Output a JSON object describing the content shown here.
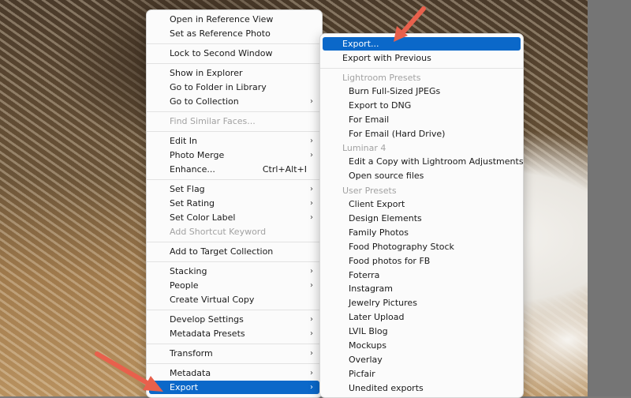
{
  "context_menu": {
    "groups": [
      [
        {
          "label": "Open in Reference View",
          "submenu": false,
          "enabled": true
        },
        {
          "label": "Set as Reference Photo",
          "submenu": false,
          "enabled": true
        }
      ],
      [
        {
          "label": "Lock to Second Window",
          "submenu": false,
          "enabled": true
        }
      ],
      [
        {
          "label": "Show in Explorer",
          "submenu": false,
          "enabled": true
        },
        {
          "label": "Go to Folder in Library",
          "submenu": false,
          "enabled": true
        },
        {
          "label": "Go to Collection",
          "submenu": true,
          "enabled": true
        }
      ],
      [
        {
          "label": "Find Similar Faces...",
          "submenu": false,
          "enabled": false
        }
      ],
      [
        {
          "label": "Edit In",
          "submenu": true,
          "enabled": true
        },
        {
          "label": "Photo Merge",
          "submenu": true,
          "enabled": true
        },
        {
          "label": "Enhance...",
          "submenu": false,
          "enabled": true,
          "shortcut": "Ctrl+Alt+I"
        }
      ],
      [
        {
          "label": "Set Flag",
          "submenu": true,
          "enabled": true
        },
        {
          "label": "Set Rating",
          "submenu": true,
          "enabled": true
        },
        {
          "label": "Set Color Label",
          "submenu": true,
          "enabled": true
        },
        {
          "label": "Add Shortcut Keyword",
          "submenu": false,
          "enabled": false
        }
      ],
      [
        {
          "label": "Add to Target Collection",
          "submenu": false,
          "enabled": true
        }
      ],
      [
        {
          "label": "Stacking",
          "submenu": true,
          "enabled": true
        },
        {
          "label": "People",
          "submenu": true,
          "enabled": true
        },
        {
          "label": "Create Virtual Copy",
          "submenu": false,
          "enabled": true
        }
      ],
      [
        {
          "label": "Develop Settings",
          "submenu": true,
          "enabled": true
        },
        {
          "label": "Metadata Presets",
          "submenu": true,
          "enabled": true
        }
      ],
      [
        {
          "label": "Transform",
          "submenu": true,
          "enabled": true
        }
      ],
      [
        {
          "label": "Metadata",
          "submenu": true,
          "enabled": true
        },
        {
          "label": "Export",
          "submenu": true,
          "enabled": true,
          "highlighted": true
        }
      ]
    ]
  },
  "export_submenu": {
    "export": "Export...",
    "export_previous": "Export with Previous",
    "lightroom_presets_header": "Lightroom Presets",
    "lightroom_presets": [
      "Burn Full-Sized JPEGs",
      "Export to DNG",
      "For Email",
      "For Email (Hard Drive)"
    ],
    "luminar_header": "Luminar 4",
    "luminar_items": [
      "Edit a Copy with Lightroom Adjustments",
      "Open source files"
    ],
    "user_presets_header": "User Presets",
    "user_presets": [
      "Client Export",
      "Design Elements",
      "Family Photos",
      "Food Photography Stock",
      "Food photos for FB",
      "Foterra",
      "Instagram",
      "Jewelry Pictures",
      "Later Upload",
      "LVIL Blog",
      "Mockups",
      "Overlay",
      "Picfair",
      "Unedited exports"
    ]
  },
  "icons": {
    "submenu_arrow": "chevron-right-icon",
    "annotation_arrow": "arrow-pointer-icon"
  },
  "colors": {
    "highlight": "#0b68c9",
    "annotation_arrow": "#e8604c",
    "disabled_text": "#a2a2a2"
  }
}
